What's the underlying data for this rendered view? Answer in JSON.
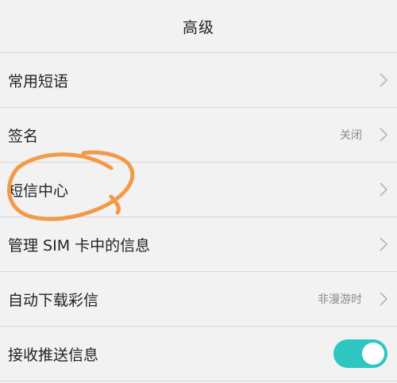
{
  "header": {
    "title": "高级"
  },
  "settings": [
    {
      "label": "常用短语",
      "value": "",
      "control": "chevron"
    },
    {
      "label": "签名",
      "value": "关闭",
      "control": "chevron"
    },
    {
      "label": "短信中心",
      "value": "",
      "control": "chevron"
    },
    {
      "label": "管理 SIM 卡中的信息",
      "value": "",
      "control": "chevron"
    },
    {
      "label": "自动下载彩信",
      "value": "非漫游时",
      "control": "chevron"
    },
    {
      "label": "接收推送信息",
      "value": "",
      "control": "toggle",
      "toggle_on": true
    }
  ],
  "colors": {
    "toggle_on": "#2ec6c0",
    "annotation_circle": "#f39a4a",
    "background": "#f2f2f2"
  },
  "icons": {
    "chevron": "chevron-right-icon"
  }
}
